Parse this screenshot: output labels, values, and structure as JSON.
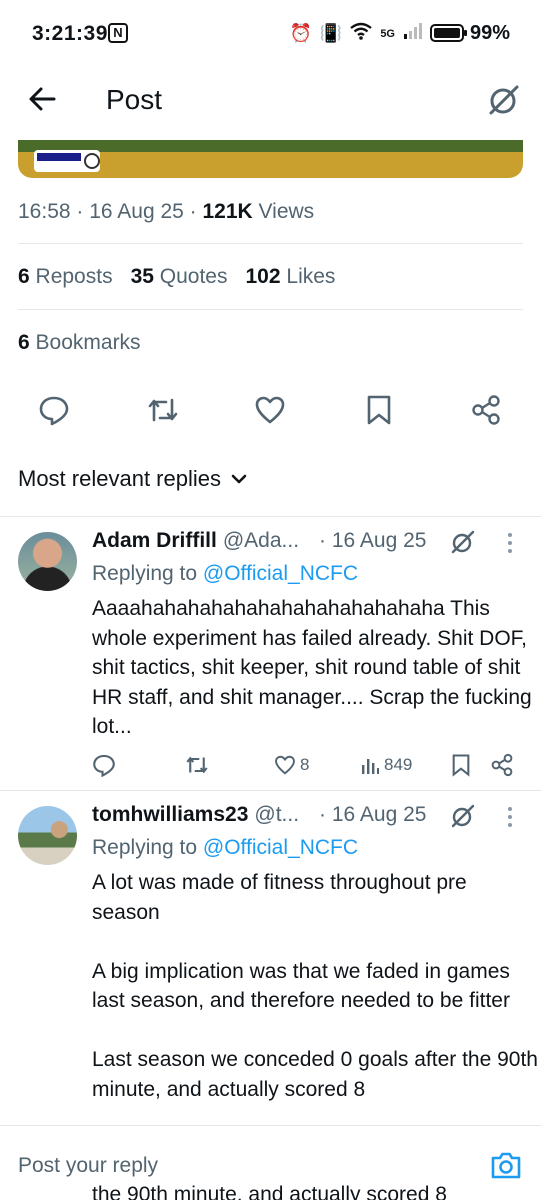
{
  "status_bar": {
    "time": "3:21:39",
    "n_icon": "N",
    "network": "5G",
    "battery": "99%"
  },
  "header": {
    "title": "Post"
  },
  "post": {
    "time": "16:58",
    "date": "16 Aug 25",
    "views_count": "121K",
    "views_label": "Views",
    "reposts_count": "6",
    "reposts_label": "Reposts",
    "quotes_count": "35",
    "quotes_label": "Quotes",
    "likes_count": "102",
    "likes_label": "Likes",
    "bookmarks_count": "6",
    "bookmarks_label": "Bookmarks"
  },
  "replies_filter": {
    "label": "Most relevant replies"
  },
  "replies": [
    {
      "name": "Adam Driffill",
      "handle": "@Ada...",
      "date": "· 16 Aug 25",
      "replying_prefix": "Replying to",
      "replying_to": "@Official_NCFC",
      "text": "Aaaahahahahahahahahahahahahaha This whole experiment has failed already. Shit DOF, shit tactics, shit keeper, shit round table of shit HR staff, and shit manager.... Scrap the fucking lot...",
      "likes": "8",
      "views": "849"
    },
    {
      "name": "tomhwilliams23",
      "handle": "@t...",
      "date": "· 16 Aug 25",
      "replying_prefix": "Replying to",
      "replying_to": "@Official_NCFC",
      "text": "A lot was made of fitness throughout pre season\n\nA big implication was that we faded in games last season, and therefore needed to be fitter\n\nLast season we conceded 0 goals after the 90th minute, and actually scored 8"
    }
  ],
  "compose": {
    "placeholder": "Post your reply"
  },
  "overflow_text": "the 90th minute, and actually scored 8"
}
